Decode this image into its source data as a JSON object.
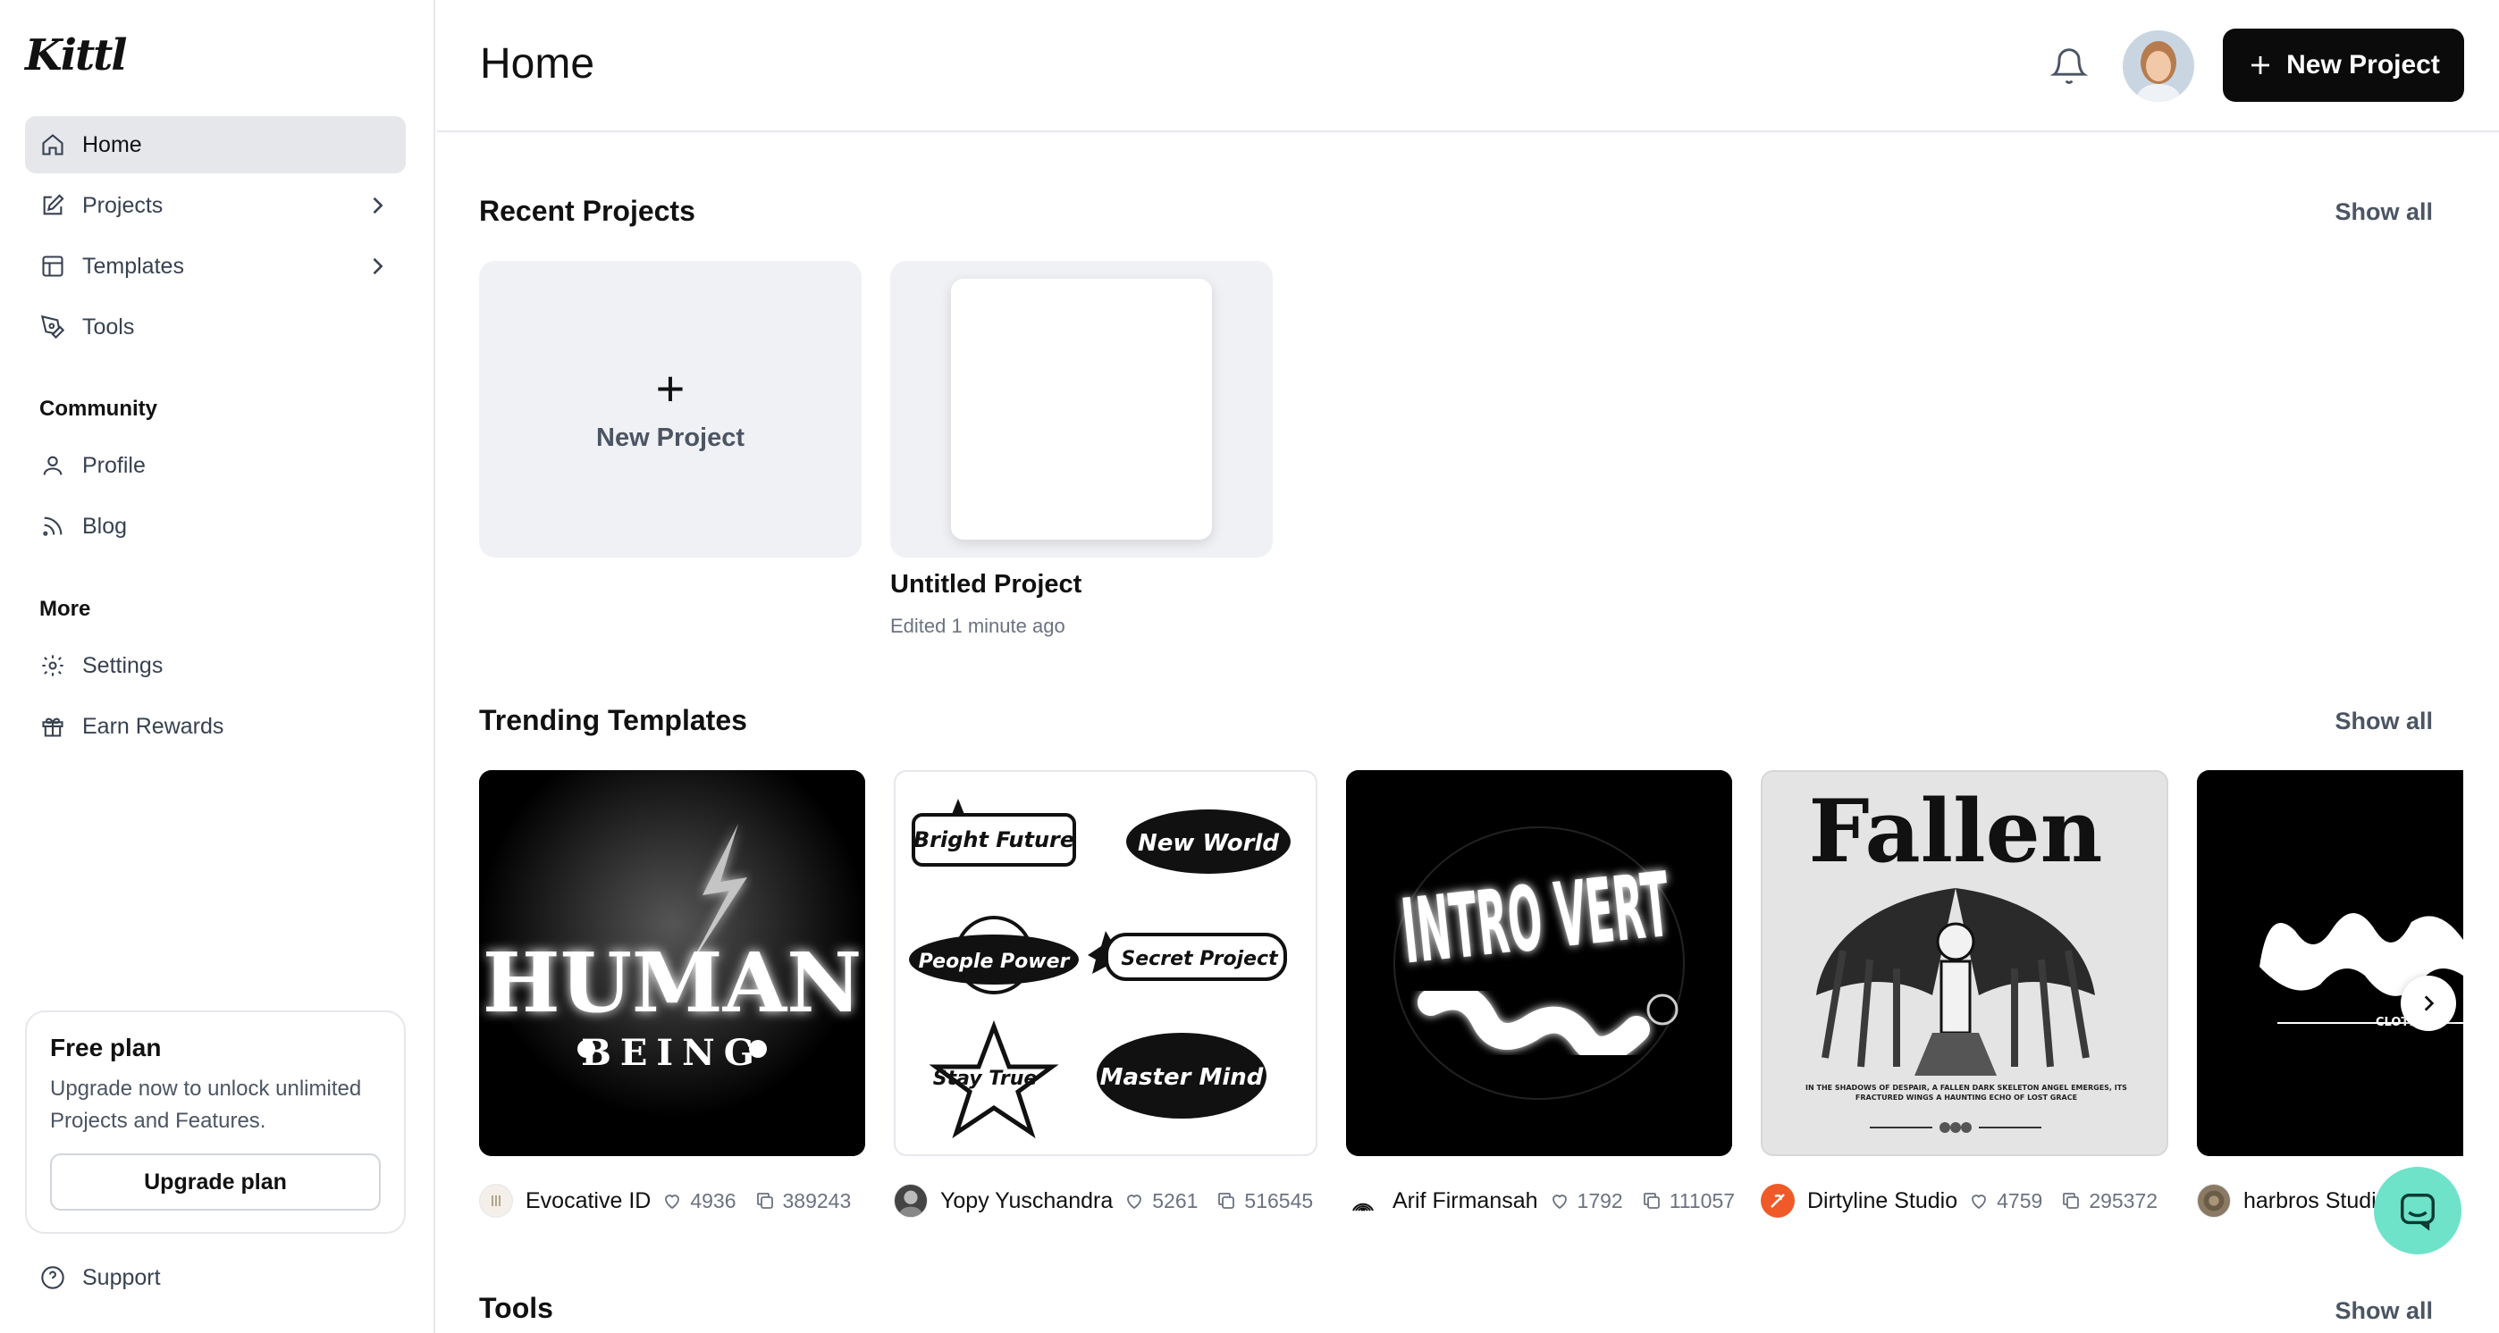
{
  "app": {
    "logo_text": "Kittl"
  },
  "sidebar": {
    "items": [
      {
        "label": "Home",
        "icon": "home-icon",
        "active": true
      },
      {
        "label": "Projects",
        "icon": "edit-icon",
        "has_submenu": true
      },
      {
        "label": "Templates",
        "icon": "template-icon",
        "has_submenu": true
      },
      {
        "label": "Tools",
        "icon": "pen-tool-icon"
      }
    ],
    "community": {
      "title": "Community",
      "items": [
        {
          "label": "Profile",
          "icon": "user-icon"
        },
        {
          "label": "Blog",
          "icon": "rss-icon"
        }
      ]
    },
    "more": {
      "title": "More",
      "items": [
        {
          "label": "Settings",
          "icon": "gear-icon"
        },
        {
          "label": "Earn Rewards",
          "icon": "gift-icon"
        }
      ]
    },
    "plan": {
      "title": "Free plan",
      "description": "Upgrade now to unlock unlimited Projects and Features.",
      "button": "Upgrade plan"
    },
    "support": {
      "label": "Support",
      "icon": "help-circle-icon"
    }
  },
  "header": {
    "title": "Home",
    "new_project_button": "New Project"
  },
  "recent_projects": {
    "title": "Recent Projects",
    "show_all": "Show all",
    "new_card_label": "New Project",
    "projects": [
      {
        "name": "Untitled Project",
        "edited": "Edited 1 minute ago"
      }
    ]
  },
  "trending_templates": {
    "title": "Trending Templates",
    "show_all": "Show all",
    "items": [
      {
        "artwork_text": "HUMAN",
        "artwork_subtext": "BEING",
        "author": "Evocative ID",
        "likes": "4936",
        "uses": "389243"
      },
      {
        "artwork_labels": [
          "Bright Future",
          "New World",
          "People Power",
          "Secret Project",
          "Stay True",
          "Master Mind"
        ],
        "author": "Yopy Yuschandra",
        "likes": "5261",
        "uses": "516545"
      },
      {
        "artwork_text": "INTRO VERT",
        "author": "Arif Firmansah",
        "likes": "1792",
        "uses": "111057"
      },
      {
        "artwork_text": "Fallen",
        "artwork_caption": "IN THE SHADOWS OF DESPAIR, A FALLEN DARK SKELETON ANGEL EMERGES, ITS FRACTURED WINGS A HAUNTING ECHO OF LOST GRACE",
        "author": "Dirtyline Studio",
        "likes": "4759",
        "uses": "295372"
      },
      {
        "artwork_subtext": "CLOTHING",
        "author": "harbros Studio",
        "likes": "",
        "uses": ""
      }
    ]
  },
  "tools": {
    "title": "Tools",
    "show_all": "Show all"
  },
  "colors": {
    "primary": "#0b0b0c",
    "active_bg": "#e5e7eb",
    "card_bg": "#f0f1f5",
    "chat": "#6ee3c9"
  }
}
